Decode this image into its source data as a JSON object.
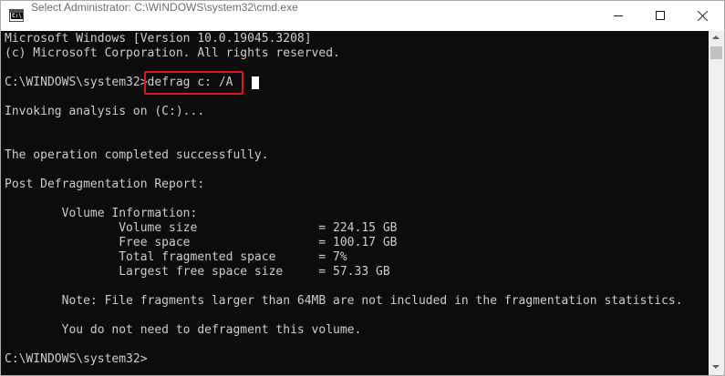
{
  "window": {
    "title": "Select Administrator: C:\\WINDOWS\\system32\\cmd.exe",
    "app_icon": "cmd-icon",
    "controls": [
      "minimize-icon",
      "maximize-icon",
      "close-icon"
    ]
  },
  "console": {
    "lines": [
      "Microsoft Windows [Version 10.0.19045.3208]",
      "(c) Microsoft Corporation. All rights reserved.",
      "",
      "Invoking analysis on (C:)...",
      "",
      "",
      "The operation completed successfully.",
      "",
      "Post Defragmentation Report:",
      "",
      "        Volume Information:",
      "                Volume size                 = 224.15 GB",
      "                Free space                  = 100.17 GB",
      "                Total fragmented space      = 7%",
      "                Largest free space size     = 57.33 GB",
      "",
      "        Note: File fragments larger than 64MB are not included in the fragmentation statistics.",
      "",
      "        You do not need to defragment this volume.",
      "",
      "C:\\WINDOWS\\system32>"
    ],
    "prompt": "C:\\WINDOWS\\system32>",
    "command": "defrag c: /A",
    "highlight_color": "#e0161f"
  }
}
